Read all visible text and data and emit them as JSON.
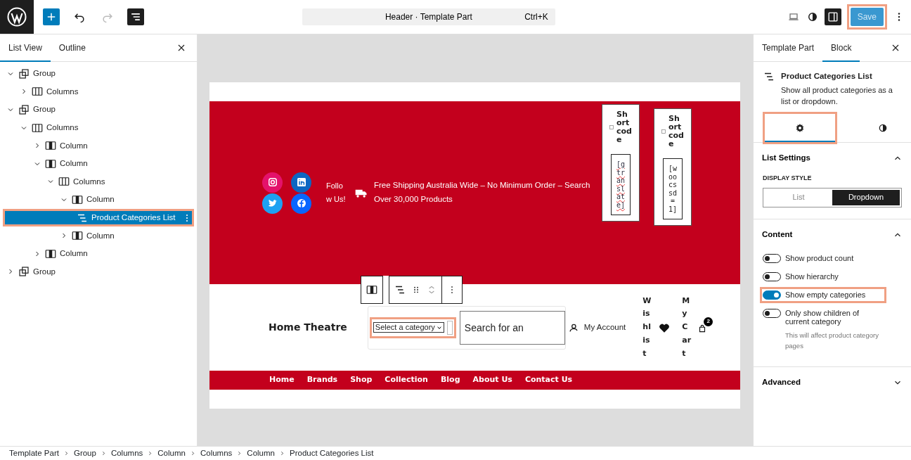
{
  "topbar": {
    "list_view_open": true,
    "settings_open": true,
    "document_title": "Header · Template Part",
    "shortcut": "Ctrl+K",
    "save": {
      "label": "Save",
      "disabled": true,
      "highlighted": true
    }
  },
  "left_panel": {
    "tabs": [
      {
        "label": "List View",
        "selected": true
      },
      {
        "label": "Outline",
        "selected": false
      }
    ],
    "tree": [
      {
        "label": "Group",
        "kind": "group",
        "expanded": true,
        "selected": false,
        "highlighted": false,
        "children": [
          {
            "label": "Columns",
            "kind": "columns",
            "expanded": false,
            "selected": false,
            "highlighted": false
          }
        ]
      },
      {
        "label": "Group",
        "kind": "group",
        "expanded": true,
        "selected": false,
        "highlighted": false,
        "children": [
          {
            "label": "Columns",
            "kind": "columns",
            "expanded": true,
            "selected": false,
            "highlighted": false,
            "children": [
              {
                "label": "Column",
                "kind": "column",
                "expanded": false,
                "selected": false,
                "highlighted": false
              },
              {
                "label": "Column",
                "kind": "column",
                "expanded": true,
                "selected": false,
                "highlighted": false,
                "children": [
                  {
                    "label": "Columns",
                    "kind": "columns",
                    "expanded": true,
                    "selected": false,
                    "highlighted": false,
                    "children": [
                      {
                        "label": "Column",
                        "kind": "column",
                        "expanded": true,
                        "selected": false,
                        "highlighted": false,
                        "children": [
                          {
                            "label": "Product Categories List",
                            "kind": "list",
                            "selected": true,
                            "highlighted": true
                          }
                        ]
                      },
                      {
                        "label": "Column",
                        "kind": "column",
                        "expanded": false,
                        "selected": false,
                        "highlighted": false
                      }
                    ]
                  }
                ]
              },
              {
                "label": "Column",
                "kind": "column",
                "expanded": false,
                "selected": false,
                "highlighted": false
              }
            ]
          }
        ]
      },
      {
        "label": "Group",
        "kind": "group",
        "expanded": false,
        "selected": false,
        "highlighted": false
      }
    ]
  },
  "canvas": {
    "socials": [
      {
        "kind": "instagram",
        "color": "#e4126b"
      },
      {
        "kind": "linkedin",
        "color": "#0d66c2"
      },
      {
        "kind": "twitter",
        "color": "#1da1f2"
      },
      {
        "kind": "facebook",
        "color": "#0866ff"
      }
    ],
    "follow_text": "Follow Us!",
    "shipping_text": "Free Shipping Australia Wide – No Minimum Order – Search Over 30,000 Products",
    "shortcodes": [
      {
        "title": "Shortcode",
        "code": "[gtranslate]",
        "misspelled": true
      },
      {
        "title": "Shortcode",
        "code": "[woocssd=1]",
        "misspelled": false
      }
    ],
    "site_title": "Home Theatre",
    "category_select": {
      "value": "Select a category",
      "highlighted": true
    },
    "search": {
      "placeholder": "Search for an"
    },
    "account": "My Account",
    "wishlist": "Wishlist",
    "cart": {
      "label": "My Cart",
      "count": "2"
    },
    "nav": [
      "Home",
      "Brands",
      "Shop",
      "Collection",
      "Blog",
      "About Us",
      "Contact Us"
    ]
  },
  "right_panel": {
    "tabs": [
      {
        "label": "Template Part",
        "selected": false
      },
      {
        "label": "Block",
        "selected": true
      }
    ],
    "block": {
      "title": "Product Categories List",
      "description": "Show all product categories as a list or dropdown."
    },
    "inspector_tabs": [
      {
        "kind": "settings",
        "selected": true,
        "highlighted": true
      },
      {
        "kind": "styles",
        "selected": false,
        "highlighted": false
      }
    ],
    "sections": [
      {
        "title": "List Settings",
        "expanded": true,
        "kind": "segmented",
        "label": "DISPLAY STYLE",
        "options": [
          {
            "label": "List",
            "selected": false
          },
          {
            "label": "Dropdown",
            "selected": true
          }
        ]
      },
      {
        "title": "Content",
        "expanded": true,
        "kind": "toggles",
        "toggles": [
          {
            "label": "Show product count",
            "on": false
          },
          {
            "label": "Show hierarchy",
            "on": false
          },
          {
            "label": "Show empty categories",
            "on": true,
            "highlighted": true
          },
          {
            "label": "Only show children of current category",
            "on": false,
            "help": "This will affect product category pages"
          }
        ]
      },
      {
        "title": "Advanced",
        "expanded": false
      }
    ]
  },
  "breadcrumbs": [
    "Template Part",
    "Group",
    "Columns",
    "Column",
    "Columns",
    "Column",
    "Product Categories List"
  ]
}
